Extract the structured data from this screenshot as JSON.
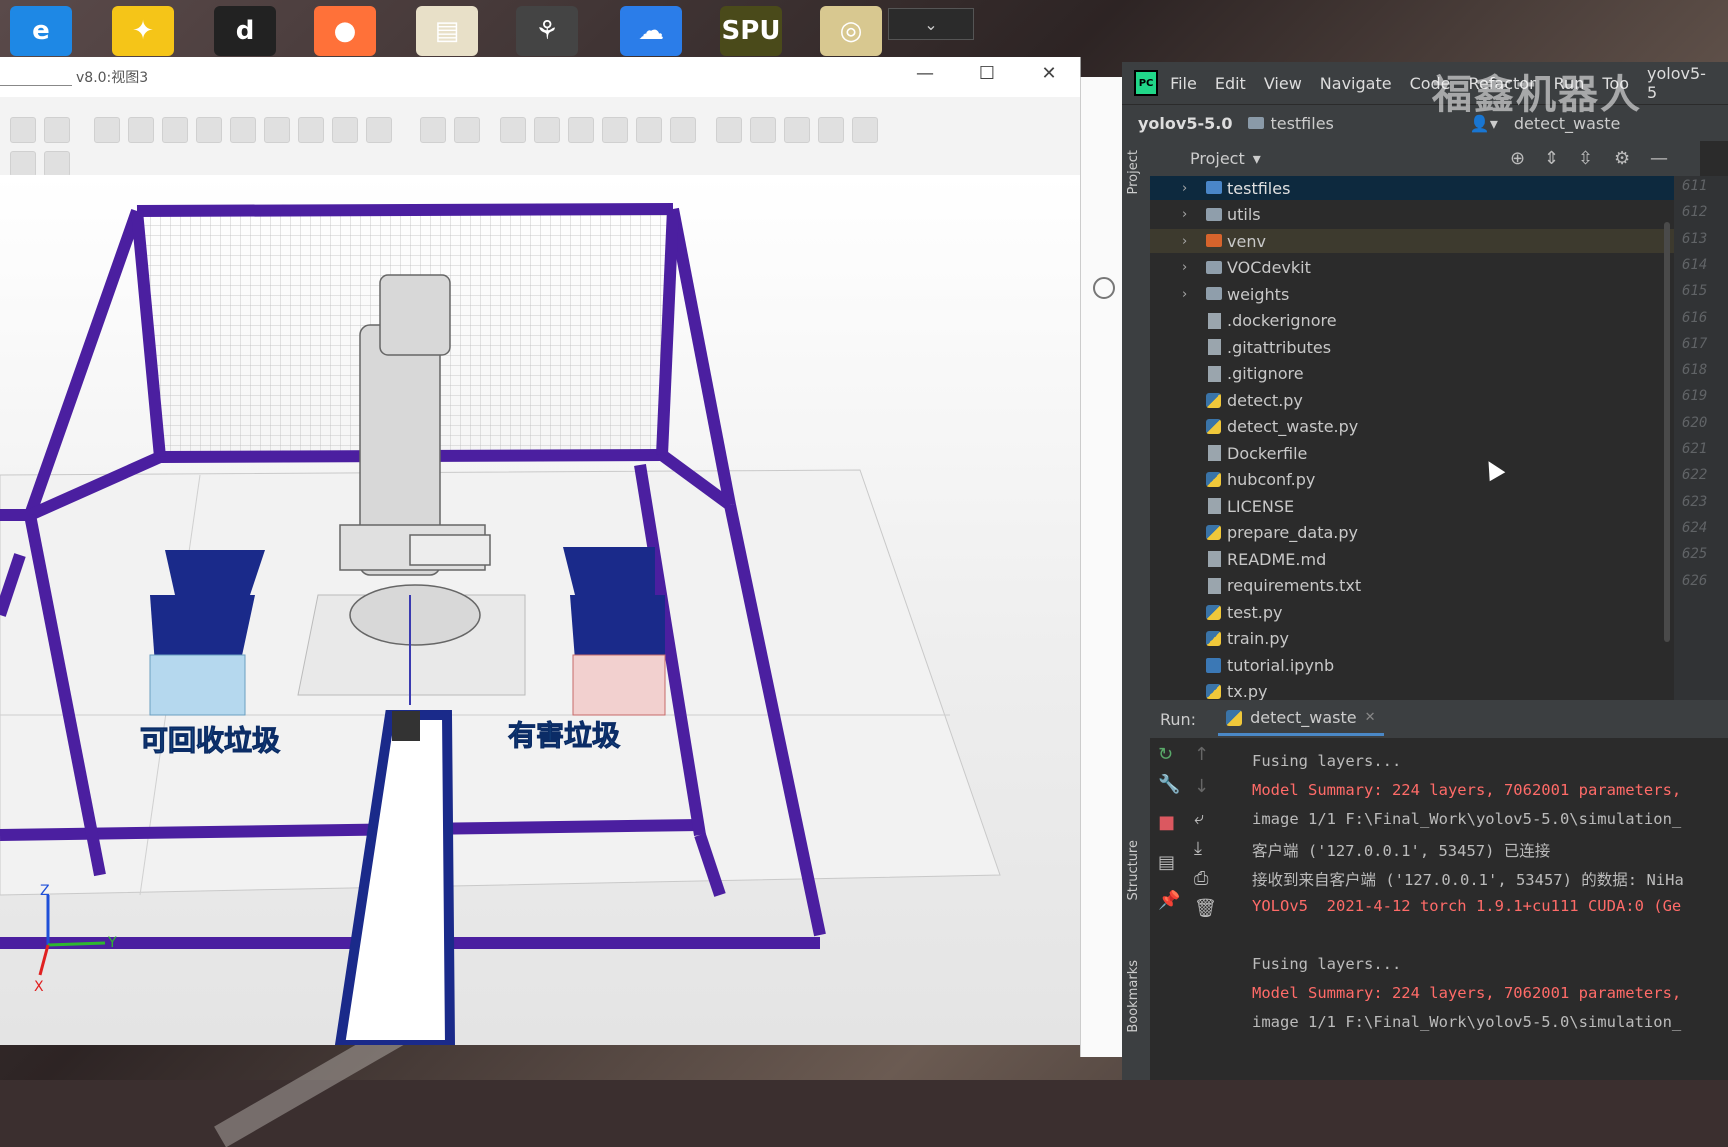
{
  "colors": {
    "accent": "#4a88c7",
    "error": "#ff6b68",
    "frame": "#4b1fa0",
    "bin_blue": "#1a2a8a"
  },
  "desktop_icons": [
    {
      "name": "ie-icon",
      "glyph": "e",
      "color": "#1e88e5"
    },
    {
      "name": "media-player-icon",
      "glyph": "✦",
      "color": "#f5c518"
    },
    {
      "name": "d-app-icon",
      "glyph": "d",
      "color": "#222"
    },
    {
      "name": "firefox-icon",
      "glyph": "●",
      "color": "#ff7139"
    },
    {
      "name": "document-icon",
      "glyph": "▤",
      "color": "#e8e0c8"
    },
    {
      "name": "graph-app-icon",
      "glyph": "⚘",
      "color": "#444"
    },
    {
      "name": "cloud-icon",
      "glyph": "☁",
      "color": "#2b7de9"
    },
    {
      "name": "spu-app-icon",
      "glyph": "SPU",
      "color": "#4a4a1a"
    },
    {
      "name": "tool-app-icon",
      "glyph": "◎",
      "color": "#d8c890"
    }
  ],
  "rs": {
    "title": "v8.0:视图3"
  },
  "viewport": {
    "label_recycle": "可回收垃圾",
    "label_hazard": "有害垃圾",
    "axis_z": "Z",
    "axis_x": "X",
    "axis_y": "Y"
  },
  "pycharm": {
    "menu": [
      "File",
      "Edit",
      "View",
      "Navigate",
      "Code",
      "Refactor",
      "Run",
      "Too",
      "yolov5-5"
    ],
    "crumb": "yolov5-5.0",
    "folder": "testfiles",
    "run_config": "detect_waste",
    "project_label": "Project",
    "left_tabs": {
      "project": "Project",
      "structure": "Structure",
      "bookmarks": "Bookmarks"
    },
    "tree": [
      {
        "name": "testfiles",
        "kind": "folder-blue",
        "arrow": true,
        "sel": true
      },
      {
        "name": "utils",
        "kind": "folder",
        "arrow": true
      },
      {
        "name": "venv",
        "kind": "folder-orange",
        "arrow": true,
        "venv": true
      },
      {
        "name": "VOCdevkit",
        "kind": "folder",
        "arrow": true
      },
      {
        "name": "weights",
        "kind": "folder",
        "arrow": true
      },
      {
        "name": ".dockerignore",
        "kind": "file"
      },
      {
        "name": ".gitattributes",
        "kind": "file"
      },
      {
        "name": ".gitignore",
        "kind": "file"
      },
      {
        "name": "detect.py",
        "kind": "py"
      },
      {
        "name": "detect_waste.py",
        "kind": "py"
      },
      {
        "name": "Dockerfile",
        "kind": "file"
      },
      {
        "name": "hubconf.py",
        "kind": "py"
      },
      {
        "name": "LICENSE",
        "kind": "file"
      },
      {
        "name": "prepare_data.py",
        "kind": "py"
      },
      {
        "name": "README.md",
        "kind": "file"
      },
      {
        "name": "requirements.txt",
        "kind": "file"
      },
      {
        "name": "test.py",
        "kind": "py"
      },
      {
        "name": "train.py",
        "kind": "py"
      },
      {
        "name": "tutorial.ipynb",
        "kind": "nb"
      },
      {
        "name": "tx.py",
        "kind": "py"
      }
    ],
    "line_numbers": [
      "611",
      "612",
      "613",
      "614",
      "615",
      "616",
      "617",
      "618",
      "619",
      "620",
      "621",
      "622",
      "623",
      "624",
      "625",
      "626"
    ],
    "run": {
      "label": "Run:",
      "tab": "detect_waste",
      "lines": [
        {
          "text": "Fusing layers...",
          "style": "norm"
        },
        {
          "text": "Model Summary: 224 layers, 7062001 parameters,",
          "style": "red"
        },
        {
          "text": "image 1/1 F:\\Final_Work\\yolov5-5.0\\simulation_",
          "style": "norm"
        },
        {
          "text": "客户端 ('127.0.0.1', 53457) 已连接",
          "style": "norm"
        },
        {
          "text": "接收到来自客户端 ('127.0.0.1', 53457) 的数据: NiHa",
          "style": "norm"
        },
        {
          "text": "YOLOv5  2021-4-12 torch 1.9.1+cu111 CUDA:0 (Ge",
          "style": "red"
        },
        {
          "text": "",
          "style": "norm"
        },
        {
          "text": "Fusing layers...",
          "style": "norm"
        },
        {
          "text": "Model Summary: 224 layers, 7062001 parameters,",
          "style": "red"
        },
        {
          "text": "image 1/1 F:\\Final_Work\\yolov5-5.0\\simulation_",
          "style": "norm"
        }
      ]
    }
  },
  "watermark": "福鑫机器人"
}
